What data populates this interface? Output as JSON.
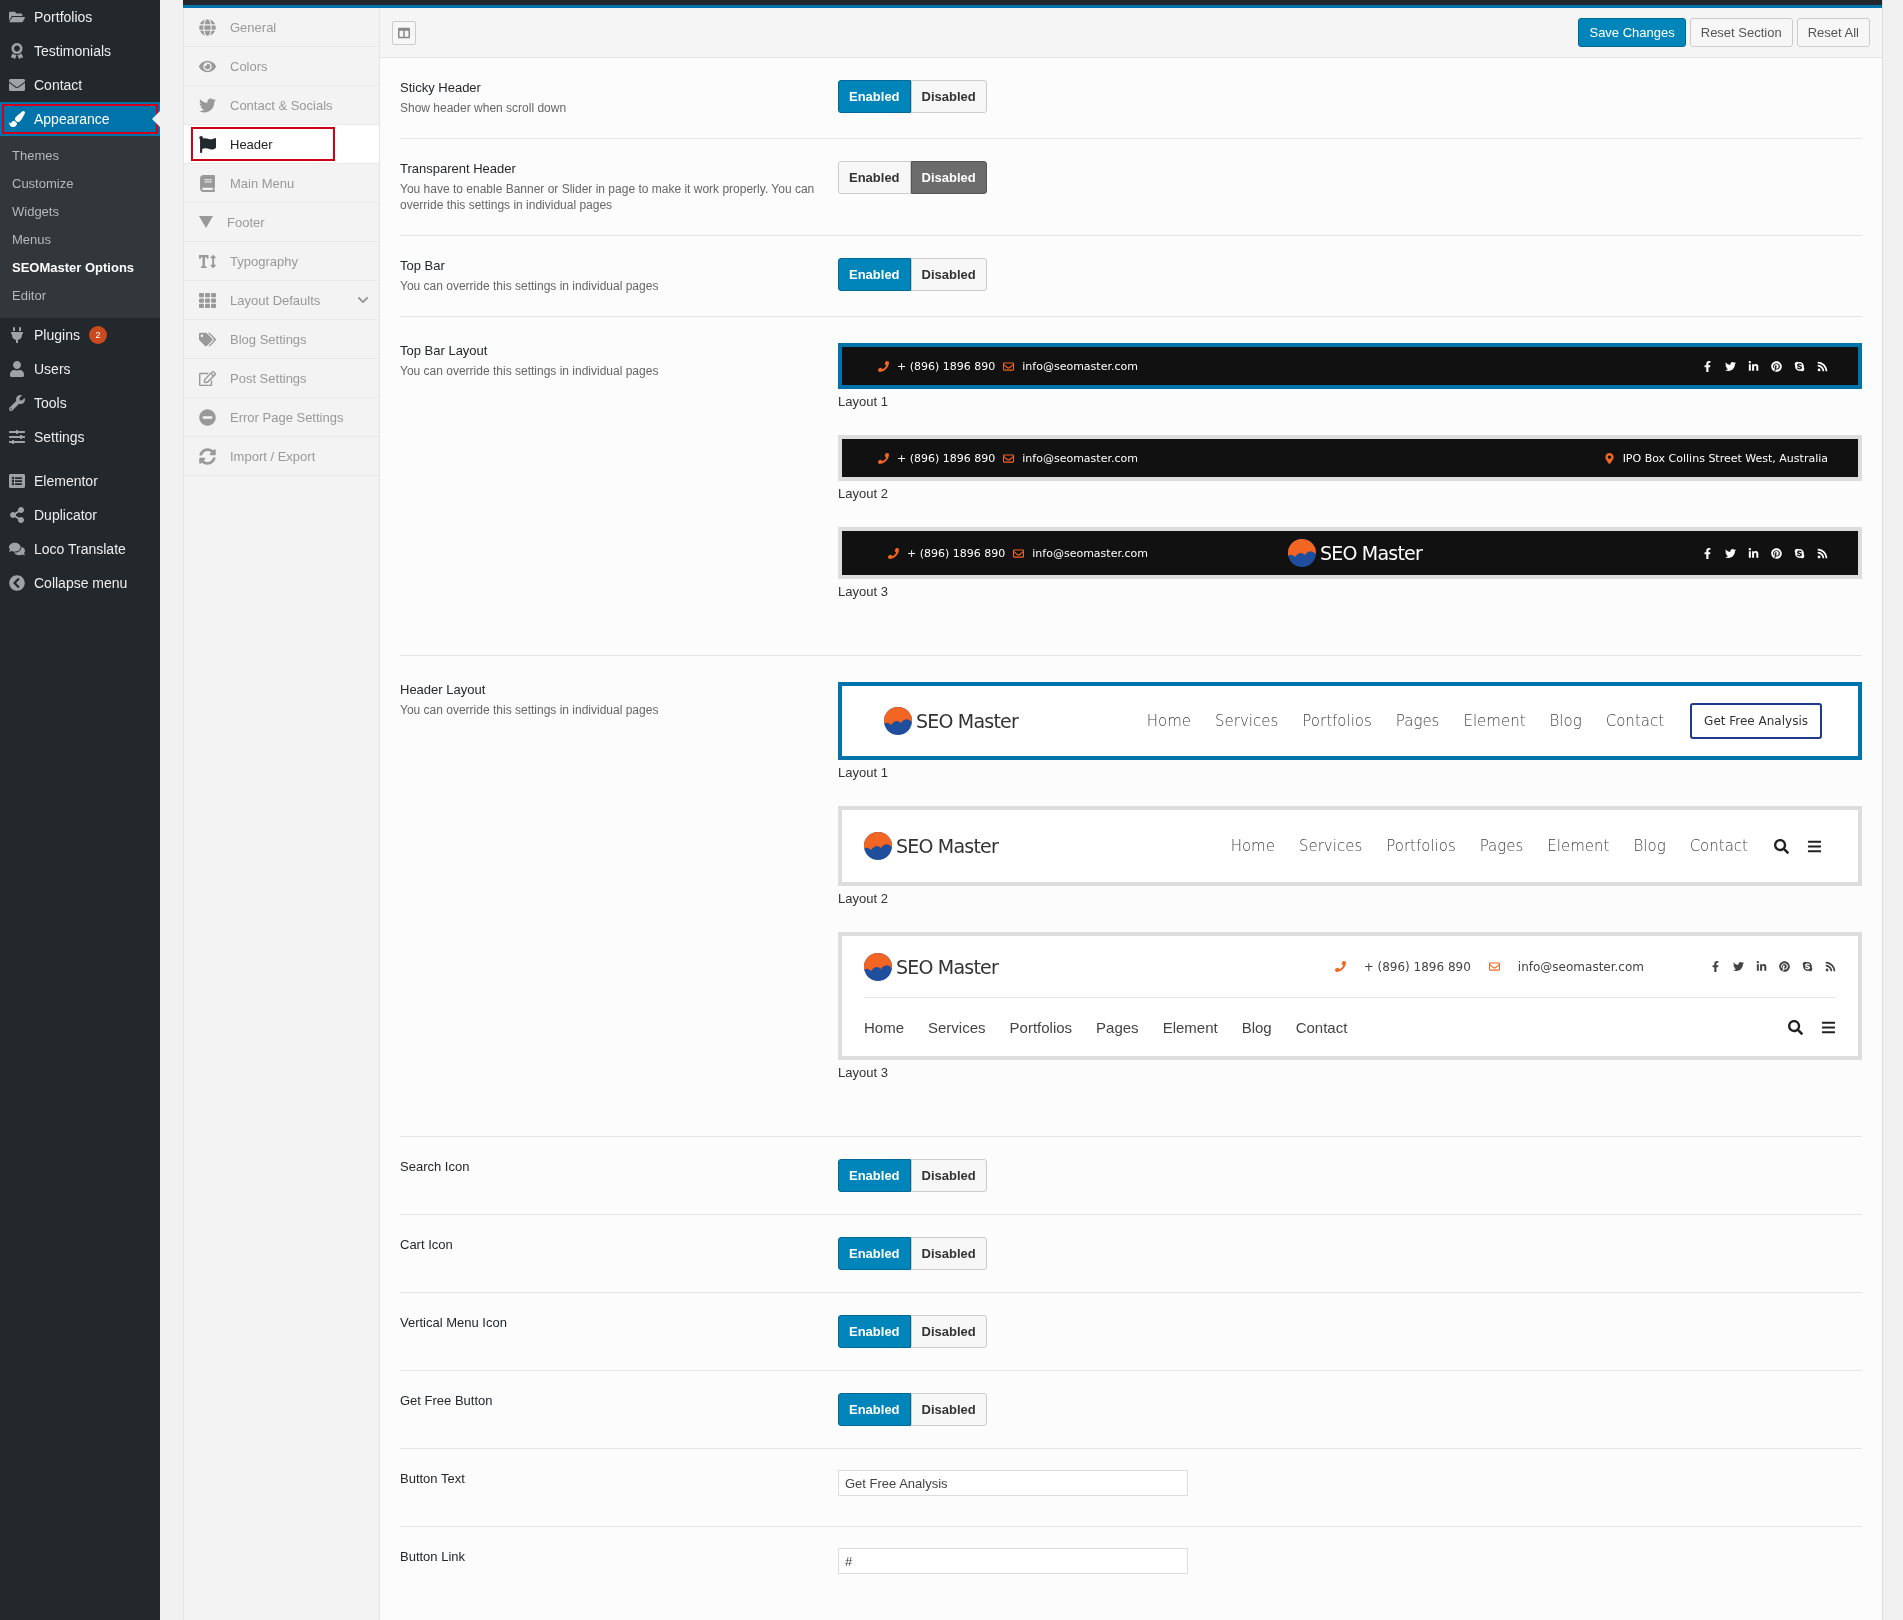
{
  "sidebar": {
    "groups": [
      {
        "items": [
          {
            "label": "Portfolios",
            "selected": false,
            "highlighted": false
          },
          {
            "label": "Testimonials",
            "selected": false,
            "highlighted": false
          },
          {
            "label": "Contact",
            "selected": false,
            "highlighted": false
          },
          {
            "label": "Appearance",
            "selected": true,
            "highlighted": true,
            "children": [
              {
                "label": "Themes",
                "selected": false
              },
              {
                "label": "Customize",
                "selected": false
              },
              {
                "label": "Widgets",
                "selected": false
              },
              {
                "label": "Menus",
                "selected": false
              },
              {
                "label": "SEOMaster Options",
                "selected": true
              },
              {
                "label": "Editor",
                "selected": false
              }
            ]
          },
          {
            "label": "Plugins",
            "selected": false,
            "highlighted": false,
            "badge": "2"
          },
          {
            "label": "Users",
            "selected": false,
            "highlighted": false
          },
          {
            "label": "Tools",
            "selected": false,
            "highlighted": false
          },
          {
            "label": "Settings",
            "selected": false,
            "highlighted": false
          }
        ]
      },
      {
        "items": [
          {
            "label": "Elementor",
            "selected": false,
            "highlighted": false
          },
          {
            "label": "Duplicator",
            "selected": false,
            "highlighted": false
          },
          {
            "label": "Loco Translate",
            "selected": false,
            "highlighted": false
          },
          {
            "label": "Collapse menu",
            "selected": false,
            "highlighted": false
          }
        ]
      }
    ]
  },
  "options_menu": {
    "items": [
      {
        "label": "General",
        "selected": false,
        "highlighted": false
      },
      {
        "label": "Colors",
        "selected": false,
        "highlighted": false
      },
      {
        "label": "Contact & Socials",
        "selected": false,
        "highlighted": false
      },
      {
        "label": "Header",
        "selected": true,
        "highlighted": true
      },
      {
        "label": "Main Menu",
        "selected": false,
        "highlighted": false
      },
      {
        "label": "Footer",
        "selected": false,
        "highlighted": false
      },
      {
        "label": "Typography",
        "selected": false,
        "highlighted": false
      },
      {
        "label": "Layout Defaults",
        "selected": false,
        "highlighted": false,
        "expandable": true
      },
      {
        "label": "Blog Settings",
        "selected": false,
        "highlighted": false
      },
      {
        "label": "Post Settings",
        "selected": false,
        "highlighted": false
      },
      {
        "label": "Error Page Settings",
        "selected": false,
        "highlighted": false
      },
      {
        "label": "Import / Export",
        "selected": false,
        "highlighted": false
      }
    ]
  },
  "toolbar": {
    "buttons": [
      {
        "label": "Save Changes",
        "primary": true
      },
      {
        "label": "Reset Section",
        "primary": false
      },
      {
        "label": "Reset All",
        "primary": false
      }
    ]
  },
  "settings": [
    {
      "kind": "toggle",
      "title": "Sticky Header",
      "description": "Show header when scroll down",
      "options": [
        {
          "label": "Enabled",
          "selected": true
        },
        {
          "label": "Disabled",
          "selected": false
        }
      ]
    },
    {
      "kind": "toggle",
      "title": "Transparent Header",
      "description": "You have to enable Banner or Slider in page to make it work properly. You can override this settings in individual pages",
      "options": [
        {
          "label": "Enabled",
          "selected": false
        },
        {
          "label": "Disabled",
          "selected": true
        }
      ]
    },
    {
      "kind": "toggle",
      "title": "Top Bar",
      "description": "You can override this settings in individual pages",
      "options": [
        {
          "label": "Enabled",
          "selected": true
        },
        {
          "label": "Disabled",
          "selected": false
        }
      ]
    },
    {
      "kind": "layouts",
      "title": "Top Bar Layout",
      "description": "You can override this settings in individual pages",
      "options": [
        {
          "kind": "topbar_socials",
          "selected": true,
          "caption": "Layout 1",
          "phone": "+ (896) 1896 890",
          "email": "info@seomaster.com"
        },
        {
          "kind": "topbar_address",
          "selected": false,
          "caption": "Layout 2",
          "phone": "+ (896) 1896 890",
          "email": "info@seomaster.com",
          "address": "IPO Box Collins Street West, Australia"
        },
        {
          "kind": "topbar_logo",
          "selected": false,
          "caption": "Layout 3",
          "phone": "+ (896) 1896 890",
          "email": "info@seomaster.com",
          "logo": "SEO Master"
        }
      ]
    },
    {
      "kind": "layouts",
      "title": "Header Layout",
      "description": "You can override this settings in individual pages",
      "options": [
        {
          "kind": "header_button",
          "selected": true,
          "caption": "Layout 1",
          "logo": "SEO Master",
          "nav": [
            "Home",
            "Services",
            "Portfolios",
            "Pages",
            "Element",
            "Blog",
            "Contact"
          ],
          "button": "Get Free Analysis"
        },
        {
          "kind": "header_icons",
          "selected": false,
          "caption": "Layout 2",
          "logo": "SEO Master",
          "nav": [
            "Home",
            "Services",
            "Portfolios",
            "Pages",
            "Element",
            "Blog",
            "Contact"
          ]
        },
        {
          "kind": "header_two_rows",
          "selected": false,
          "caption": "Layout 3",
          "logo": "SEO Master",
          "phone": "+ (896) 1896 890",
          "email": "info@seomaster.com",
          "nav": [
            "Home",
            "Services",
            "Portfolios",
            "Pages",
            "Element",
            "Blog",
            "Contact"
          ]
        }
      ]
    },
    {
      "kind": "toggle",
      "title": "Search Icon",
      "options": [
        {
          "label": "Enabled",
          "selected": true
        },
        {
          "label": "Disabled",
          "selected": false
        }
      ]
    },
    {
      "kind": "toggle",
      "title": "Cart Icon",
      "options": [
        {
          "label": "Enabled",
          "selected": true
        },
        {
          "label": "Disabled",
          "selected": false
        }
      ]
    },
    {
      "kind": "toggle",
      "title": "Vertical Menu Icon",
      "options": [
        {
          "label": "Enabled",
          "selected": true
        },
        {
          "label": "Disabled",
          "selected": false
        }
      ]
    },
    {
      "kind": "toggle",
      "title": "Get Free Button",
      "options": [
        {
          "label": "Enabled",
          "selected": true
        },
        {
          "label": "Disabled",
          "selected": false
        }
      ]
    },
    {
      "kind": "text",
      "title": "Button Text",
      "value": "Get Free Analysis"
    },
    {
      "kind": "text",
      "title": "Button Link",
      "value": "#"
    }
  ]
}
